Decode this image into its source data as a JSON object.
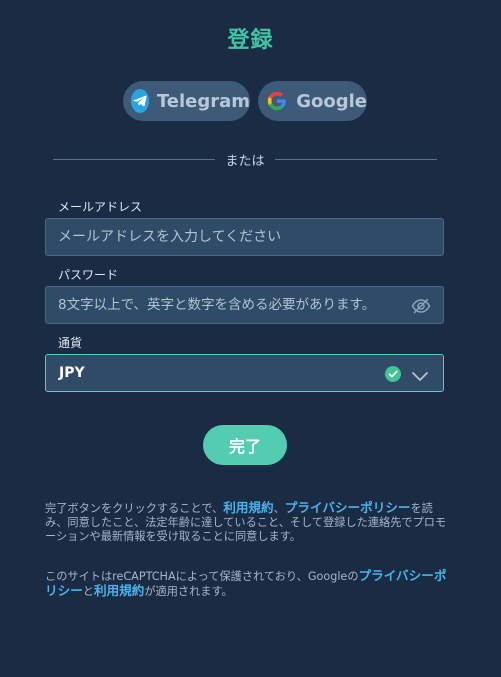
{
  "page": {
    "title": "登録"
  },
  "social": {
    "telegram_label": "Telegram",
    "google_label": "Google"
  },
  "divider": {
    "text": "または"
  },
  "email": {
    "label": "メールアドレス",
    "placeholder": "メールアドレスを入力してください"
  },
  "password": {
    "label": "パスワード",
    "placeholder": "8文字以上で、英字と数字を含める必要があります。"
  },
  "currency": {
    "label": "通貨",
    "value": "JPY"
  },
  "submit": {
    "label": "完了"
  },
  "terms": {
    "part1": "完了ボタンをクリックすることで、",
    "link_terms": "利用規約",
    "sep": "、",
    "link_privacy": "プライバシーポリシー",
    "part2": "を読み、同意したこと、法定年齢に達していること、そして登録した連絡先でプロモーションや最新情報を受け取ることに同意します。"
  },
  "recaptcha": {
    "part1": "このサイトはreCAPTCHAによって保護されており、Googleの",
    "link_privacy": "プライバシーポリシー",
    "part2": "と",
    "link_terms": "利用規約",
    "part3": "が適用されます。"
  },
  "colors": {
    "background": "#1a2b44",
    "accent": "#3fc4a4",
    "link": "#4ab3ee",
    "button": "#52cdb2"
  }
}
